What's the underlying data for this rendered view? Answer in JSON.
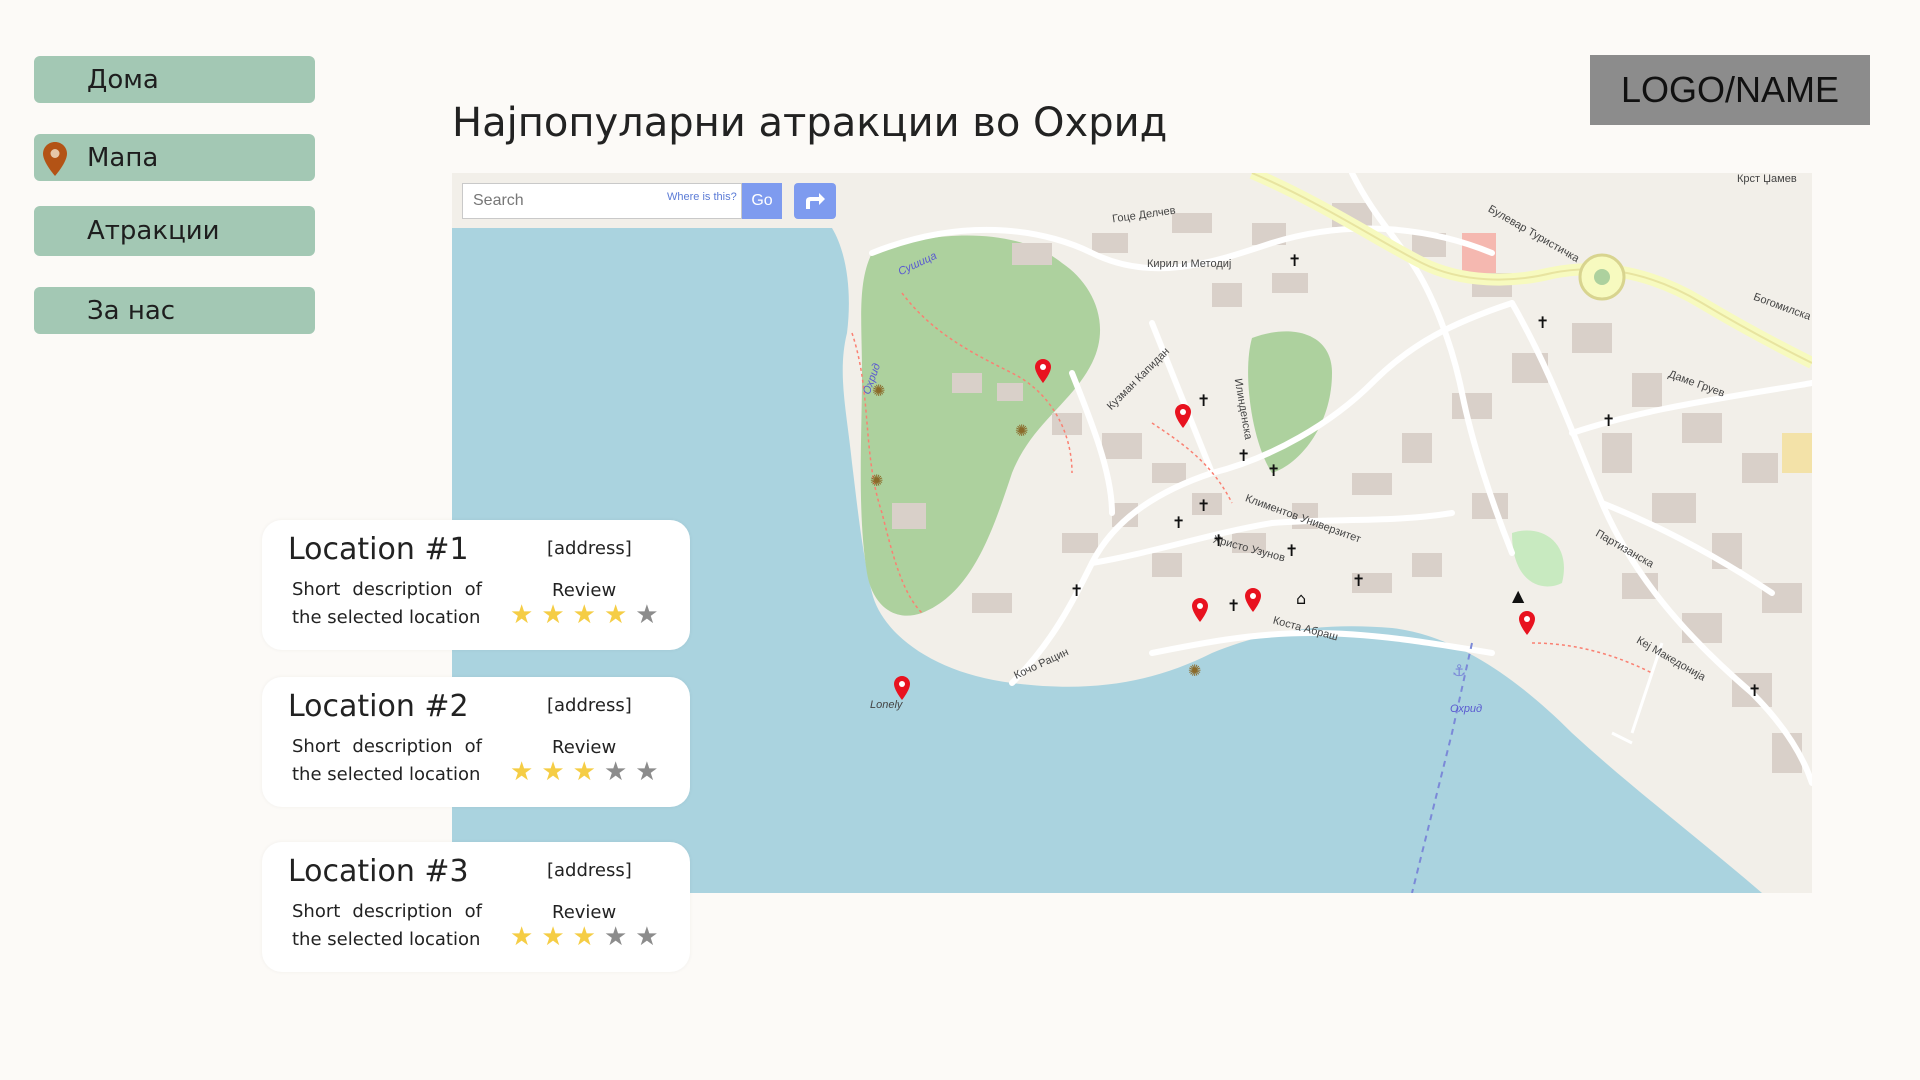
{
  "sidebar": {
    "items": [
      {
        "label": "Дома",
        "icon": null
      },
      {
        "label": "Мапа",
        "icon": "map-pin-icon"
      },
      {
        "label": "Атракции",
        "icon": null
      },
      {
        "label": "За нас",
        "icon": null
      }
    ]
  },
  "logo": {
    "text": "LOGO/NAME"
  },
  "title": "Најпопуларни атракции во Охрид",
  "map": {
    "search": {
      "placeholder": "Search",
      "where_link": "Where is this?",
      "go_label": "Go",
      "directions_icon": "directions-icon"
    },
    "labels": {
      "lake_area": "Охрид",
      "ohrid": "Охрид",
      "lonely": "Lonely",
      "boulevard": "Булевар Туристичка",
      "krst_camev": "Крст Џамев",
      "goce_delcev": "Гоце Делчев",
      "kiril_metodij": "Кирил и Методиј",
      "kuzman_kapidan": "Кузман Капидан",
      "ilindenska": "Илинденска",
      "kliment_univerzitet": "Климентов Универзитет",
      "hristo_uzunov": "Христо Узунов",
      "kosta_abrasi": "Коста Абраш",
      "koco_racin": "Кочо Рацин",
      "kej_makedonija": "Кеј Македонија",
      "partizanska": "Партизанска",
      "susica": "Сушица",
      "bogomilska": "Богомилска",
      "dame_gruev": "Даме Груев"
    },
    "colors": {
      "water": "#aad3df",
      "park": "#add19e",
      "land": "#f2efe9",
      "building": "#d9d0c9",
      "marker": "#e8121f"
    }
  },
  "locations": [
    {
      "title": "Location #1",
      "address": "[address]",
      "description": "Short description of the selected location",
      "review_label": "Review",
      "rating": 4,
      "max_rating": 5,
      "stars": [
        "★",
        "★",
        "★",
        "★",
        "★"
      ]
    },
    {
      "title": "Location #2",
      "address": "[address]",
      "description": "Short description of the selected location",
      "review_label": "Review",
      "rating": 3,
      "max_rating": 5,
      "stars": [
        "★",
        "★",
        "★",
        "★",
        "★"
      ]
    },
    {
      "title": "Location #3",
      "address": "[address]",
      "description": "Short description of the selected location",
      "review_label": "Review",
      "rating": 3,
      "max_rating": 5,
      "stars": [
        "★",
        "★",
        "★",
        "★",
        "★"
      ]
    }
  ]
}
